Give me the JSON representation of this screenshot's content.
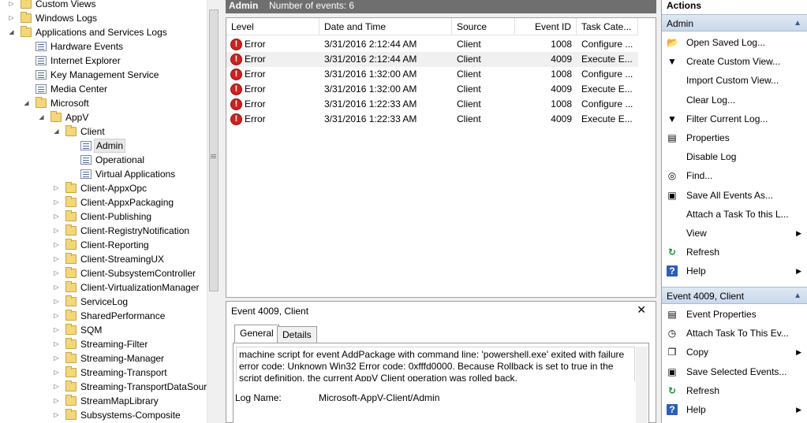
{
  "tree": {
    "items": [
      {
        "label": "Custom Views",
        "depth": 0,
        "expander": "▷",
        "icon": "folder-view"
      },
      {
        "label": "Windows Logs",
        "depth": 0,
        "expander": "▷",
        "icon": "folder-view"
      },
      {
        "label": "Applications and Services Logs",
        "depth": 0,
        "expander": "◢",
        "icon": "folder-view"
      },
      {
        "label": "Hardware Events",
        "depth": 1,
        "expander": "",
        "icon": "log"
      },
      {
        "label": "Internet Explorer",
        "depth": 1,
        "expander": "",
        "icon": "log"
      },
      {
        "label": "Key Management Service",
        "depth": 1,
        "expander": "",
        "icon": "log"
      },
      {
        "label": "Media Center",
        "depth": 1,
        "expander": "",
        "icon": "log"
      },
      {
        "label": "Microsoft",
        "depth": 1,
        "expander": "◢",
        "icon": "folder"
      },
      {
        "label": "AppV",
        "depth": 2,
        "expander": "◢",
        "icon": "folder"
      },
      {
        "label": "Client",
        "depth": 3,
        "expander": "◢",
        "icon": "folder"
      },
      {
        "label": "Admin",
        "depth": 4,
        "expander": "",
        "icon": "log",
        "selected": true
      },
      {
        "label": "Operational",
        "depth": 4,
        "expander": "",
        "icon": "log"
      },
      {
        "label": "Virtual Applications",
        "depth": 4,
        "expander": "",
        "icon": "log"
      },
      {
        "label": "Client-AppxOpc",
        "depth": 3,
        "expander": "▷",
        "icon": "folder"
      },
      {
        "label": "Client-AppxPackaging",
        "depth": 3,
        "expander": "▷",
        "icon": "folder"
      },
      {
        "label": "Client-Publishing",
        "depth": 3,
        "expander": "▷",
        "icon": "folder"
      },
      {
        "label": "Client-RegistryNotification",
        "depth": 3,
        "expander": "▷",
        "icon": "folder"
      },
      {
        "label": "Client-Reporting",
        "depth": 3,
        "expander": "▷",
        "icon": "folder"
      },
      {
        "label": "Client-StreamingUX",
        "depth": 3,
        "expander": "▷",
        "icon": "folder"
      },
      {
        "label": "Client-SubsystemController",
        "depth": 3,
        "expander": "▷",
        "icon": "folder"
      },
      {
        "label": "Client-VirtualizationManager",
        "depth": 3,
        "expander": "▷",
        "icon": "folder"
      },
      {
        "label": "ServiceLog",
        "depth": 3,
        "expander": "▷",
        "icon": "folder"
      },
      {
        "label": "SharedPerformance",
        "depth": 3,
        "expander": "▷",
        "icon": "folder"
      },
      {
        "label": "SQM",
        "depth": 3,
        "expander": "▷",
        "icon": "folder"
      },
      {
        "label": "Streaming-Filter",
        "depth": 3,
        "expander": "▷",
        "icon": "folder"
      },
      {
        "label": "Streaming-Manager",
        "depth": 3,
        "expander": "▷",
        "icon": "folder"
      },
      {
        "label": "Streaming-Transport",
        "depth": 3,
        "expander": "▷",
        "icon": "folder"
      },
      {
        "label": "Streaming-TransportDataSour",
        "depth": 3,
        "expander": "▷",
        "icon": "folder"
      },
      {
        "label": "StreamMapLibrary",
        "depth": 3,
        "expander": "▷",
        "icon": "folder"
      },
      {
        "label": "Subsystems-Composite",
        "depth": 3,
        "expander": "▷",
        "icon": "folder"
      }
    ]
  },
  "events_header": {
    "title": "Admin",
    "count_text": "Number of events: 6"
  },
  "columns": [
    "Level",
    "Date and Time",
    "Source",
    "Event ID",
    "Task Cate..."
  ],
  "events": [
    {
      "level": "Error",
      "datetime": "3/31/2016 2:12:44 AM",
      "source": "Client",
      "id": "1008",
      "task": "Configure ..."
    },
    {
      "level": "Error",
      "datetime": "3/31/2016 2:12:44 AM",
      "source": "Client",
      "id": "4009",
      "task": "Execute E..."
    },
    {
      "level": "Error",
      "datetime": "3/31/2016 1:32:00 AM",
      "source": "Client",
      "id": "1008",
      "task": "Configure ..."
    },
    {
      "level": "Error",
      "datetime": "3/31/2016 1:32:00 AM",
      "source": "Client",
      "id": "4009",
      "task": "Execute E..."
    },
    {
      "level": "Error",
      "datetime": "3/31/2016 1:22:33 AM",
      "source": "Client",
      "id": "1008",
      "task": "Configure ..."
    },
    {
      "level": "Error",
      "datetime": "3/31/2016 1:22:33 AM",
      "source": "Client",
      "id": "4009",
      "task": "Execute E..."
    }
  ],
  "detail": {
    "title": "Event 4009, Client",
    "close": "✕",
    "tabs": [
      "General",
      "Details"
    ],
    "message": "machine script for event AddPackage with command line: 'powershell.exe' exited with failure error code: Unknown Win32 Error code: 0xfffd0000. Because Rollback is set to true in the script definition, the current AppV Client operation was rolled back.",
    "log_name_label": "Log Name:",
    "log_name_value": "Microsoft-AppV-Client/Admin"
  },
  "actions": {
    "title": "Actions",
    "section1": {
      "title": "Admin",
      "items": [
        {
          "label": "Open Saved Log...",
          "icon": "open-folder-icon",
          "glyph": "📂",
          "arrow": ""
        },
        {
          "label": "Create Custom View...",
          "icon": "filter-create-icon",
          "glyph": "▼",
          "arrow": ""
        },
        {
          "label": "Import Custom View...",
          "icon": "",
          "glyph": "",
          "arrow": ""
        },
        {
          "label": "Clear Log...",
          "icon": "",
          "glyph": "",
          "arrow": ""
        },
        {
          "label": "Filter Current Log...",
          "icon": "filter-icon",
          "glyph": "▼",
          "arrow": ""
        },
        {
          "label": "Properties",
          "icon": "properties-icon",
          "glyph": "▤",
          "arrow": ""
        },
        {
          "label": "Disable Log",
          "icon": "",
          "glyph": "",
          "arrow": ""
        },
        {
          "label": "Find...",
          "icon": "binoculars-icon",
          "glyph": "◎",
          "arrow": ""
        },
        {
          "label": "Save All Events As...",
          "icon": "save-icon",
          "glyph": "▣",
          "arrow": ""
        },
        {
          "label": "Attach a Task To this L...",
          "icon": "",
          "glyph": "",
          "arrow": ""
        },
        {
          "label": "View",
          "icon": "",
          "glyph": "",
          "arrow": "▶"
        },
        {
          "label": "Refresh",
          "icon": "refresh-icon",
          "glyph": "↻",
          "arrow": ""
        },
        {
          "label": "Help",
          "icon": "help-icon",
          "glyph": "?",
          "arrow": "▶"
        }
      ]
    },
    "section2": {
      "title": "Event 4009, Client",
      "items": [
        {
          "label": "Event Properties",
          "icon": "event-properties-icon",
          "glyph": "▤",
          "arrow": ""
        },
        {
          "label": "Attach Task To This Ev...",
          "icon": "attach-task-icon",
          "glyph": "◷",
          "arrow": ""
        },
        {
          "label": "Copy",
          "icon": "copy-icon",
          "glyph": "❐",
          "arrow": "▶"
        },
        {
          "label": "Save Selected Events...",
          "icon": "save-icon",
          "glyph": "▣",
          "arrow": ""
        },
        {
          "label": "Refresh",
          "icon": "refresh-icon",
          "glyph": "↻",
          "arrow": ""
        },
        {
          "label": "Help",
          "icon": "help-icon",
          "glyph": "?",
          "arrow": "▶"
        }
      ]
    }
  }
}
